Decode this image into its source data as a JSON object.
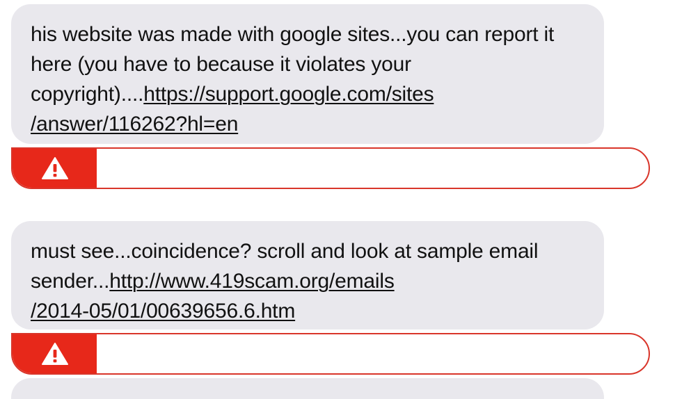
{
  "messages": [
    {
      "text": "his website was made with google sites...you can report it here (you have to because it violates your copyright)....",
      "link_line1": "https://support.google.com/sites",
      "link_line2": "/answer/116262?hl=en"
    },
    {
      "text": "must see...coincidence? scroll and look at sample email sender...",
      "link_line1": "http://www.419scam.org/emails",
      "link_line2": "/2014-05/01/00639656.6.htm"
    }
  ],
  "icons": {
    "warning": "warning-icon"
  },
  "colors": {
    "bubble_bg": "#e9e8ed",
    "warning_red": "#e7281a",
    "warning_border": "#d9352a"
  }
}
